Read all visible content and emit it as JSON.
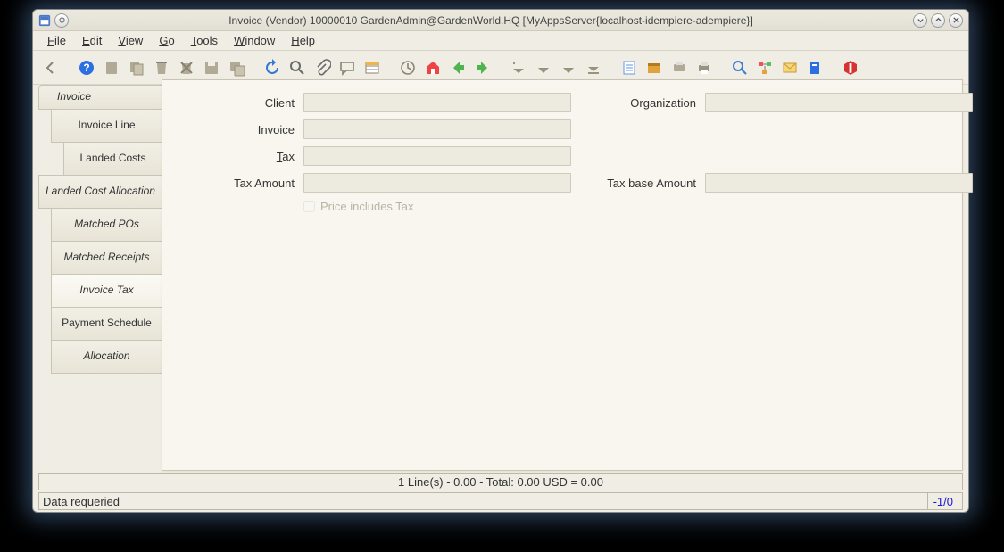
{
  "window": {
    "title": "Invoice (Vendor)  10000010  GardenAdmin@GardenWorld.HQ [MyAppsServer{localhost-idempiere-adempiere}]"
  },
  "menu": {
    "file": "File",
    "edit": "Edit",
    "view": "View",
    "go": "Go",
    "tools": "Tools",
    "window": "Window",
    "help": "Help"
  },
  "tabs": [
    {
      "label": "Invoice",
      "level": 0
    },
    {
      "label": "Invoice Line",
      "level": 1
    },
    {
      "label": "Landed Costs",
      "level": 2
    },
    {
      "label": "Landed Cost Allocation",
      "level": 1
    },
    {
      "label": "Matched POs",
      "level": 2
    },
    {
      "label": "Matched Receipts",
      "level": 2
    },
    {
      "label": "Invoice Tax",
      "level": 2,
      "active": true
    },
    {
      "label": "Payment Schedule",
      "level": 2
    },
    {
      "label": "Allocation",
      "level": 2
    }
  ],
  "form": {
    "client_label": "Client",
    "client_value": "",
    "organization_label": "Organization",
    "organization_value": "",
    "invoice_label": "Invoice",
    "invoice_value": "",
    "tax_label": "Tax",
    "tax_value": "",
    "tax_amount_label": "Tax Amount",
    "tax_amount_value": "",
    "tax_base_label": "Tax base Amount",
    "tax_base_value": "",
    "price_includes_tax_label": "Price includes Tax",
    "price_includes_tax_checked": false
  },
  "summary": "1 Line(s) - 0.00 -  Total: 0.00  USD  =  0.00",
  "status": {
    "left": "Data requeried",
    "right": "-1/0"
  }
}
